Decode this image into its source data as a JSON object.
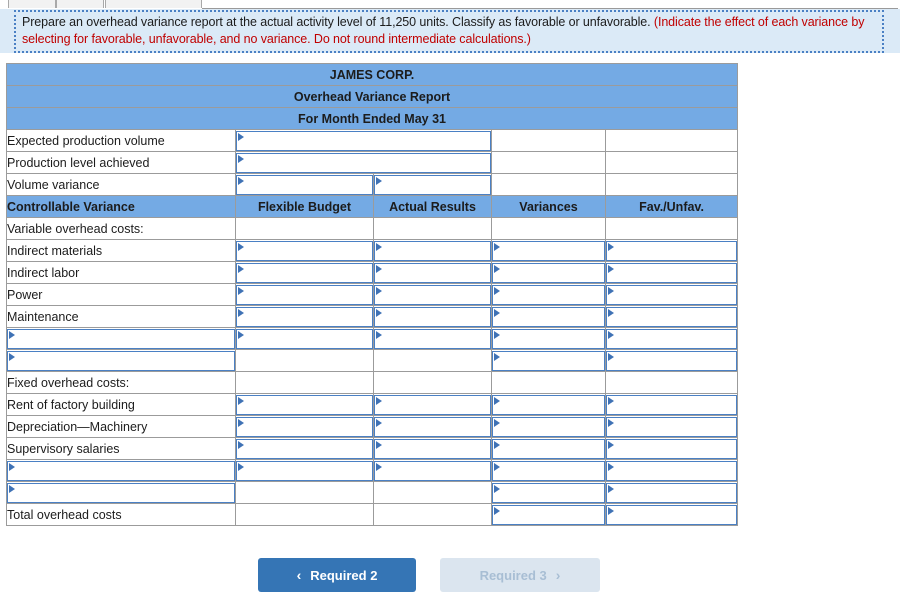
{
  "instruction": {
    "main": "Prepare an overhead variance report at the actual activity level of 11,250 units. Classify as favorable or unfavorable. ",
    "hint": "(Indicate the effect of each variance by selecting for favorable, unfavorable, and no variance. Do not round intermediate calculations.)"
  },
  "report": {
    "company": "JAMES CORP.",
    "title": "Overhead Variance Report",
    "period": "For Month Ended May 31",
    "summary_rows": [
      {
        "label": "Expected production volume"
      },
      {
        "label": "Production level achieved"
      },
      {
        "label": "Volume variance"
      }
    ],
    "columns": {
      "row_header": "Controllable Variance",
      "flexible_budget": "Flexible Budget",
      "actual_results": "Actual Results",
      "variances": "Variances",
      "fav_unfav": "Fav./Unfav."
    },
    "sections": [
      {
        "heading": "Variable overhead costs:",
        "items": [
          {
            "label": "Indirect materials"
          },
          {
            "label": "Indirect labor"
          },
          {
            "label": "Power"
          },
          {
            "label": "Maintenance"
          },
          {
            "label": ""
          },
          {
            "label": ""
          }
        ]
      },
      {
        "heading": "Fixed overhead costs:",
        "items": [
          {
            "label": "Rent of factory building"
          },
          {
            "label": "Depreciation—Machinery"
          },
          {
            "label": "Supervisory salaries"
          },
          {
            "label": ""
          },
          {
            "label": ""
          }
        ]
      }
    ],
    "total_row_label": "Total overhead costs"
  },
  "footer": {
    "prev_button": {
      "label": "Required 2",
      "chevron": "‹"
    },
    "next_button": {
      "label": "Required 3",
      "chevron": "›"
    }
  },
  "colors": {
    "header_blue": "#74aae4",
    "banner_blue": "#dbeaf7",
    "hint_red": "#c00000",
    "active_button": "#3575b5",
    "disabled_button": "#dbe5ef",
    "field_border": "#4a80c4"
  }
}
